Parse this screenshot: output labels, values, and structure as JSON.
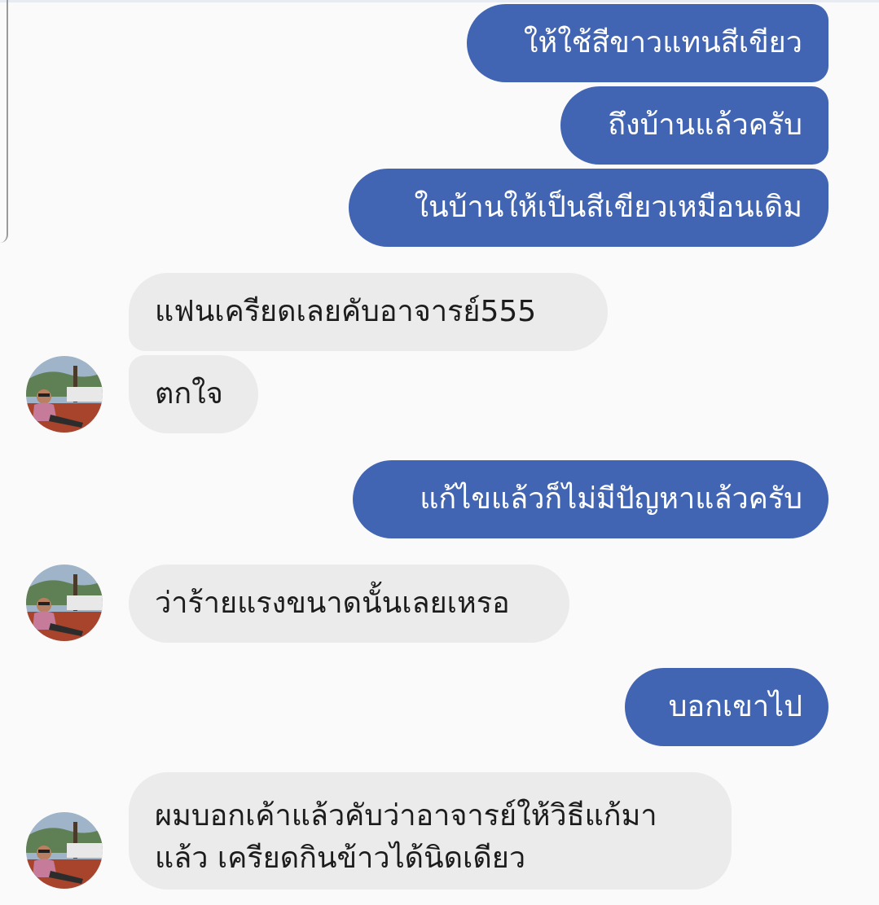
{
  "conversation": {
    "messages": [
      {
        "id": "m1",
        "direction": "outgoing",
        "text": "ให้ใช้สีขาวแทนสีเขียว"
      },
      {
        "id": "m2",
        "direction": "outgoing",
        "text": "ถึงบ้านแล้วครับ"
      },
      {
        "id": "m3",
        "direction": "outgoing",
        "text": "ในบ้านให้เป็นสีเขียวเหมือนเดิม"
      },
      {
        "id": "m4",
        "direction": "incoming",
        "text": "แฟนเครียดเลยคับอาจารย์555"
      },
      {
        "id": "m5",
        "direction": "incoming",
        "text": "ตกใจ"
      },
      {
        "id": "m6",
        "direction": "outgoing",
        "text": "แก้ไขแล้วก็ไม่มีปัญหาแล้วครับ"
      },
      {
        "id": "m7",
        "direction": "incoming",
        "text": "ว่าร้ายแรงขนาดนั้นเลยเหรอ"
      },
      {
        "id": "m8",
        "direction": "outgoing",
        "text": "บอกเขาไป"
      },
      {
        "id": "m9",
        "direction": "incoming",
        "lines": [
          "ผมบอกเค้าแล้วคับว่าอาจารย์ให้วิธีแก้มา",
          "แล้ว เครียดกินข้าวได้นิดเดียว"
        ]
      }
    ]
  },
  "colors": {
    "outgoing_bubble": "#4265b3",
    "incoming_bubble": "#ebebeb",
    "background": "#fafafa"
  },
  "icons": {
    "avatar": "contact-avatar-photo"
  }
}
